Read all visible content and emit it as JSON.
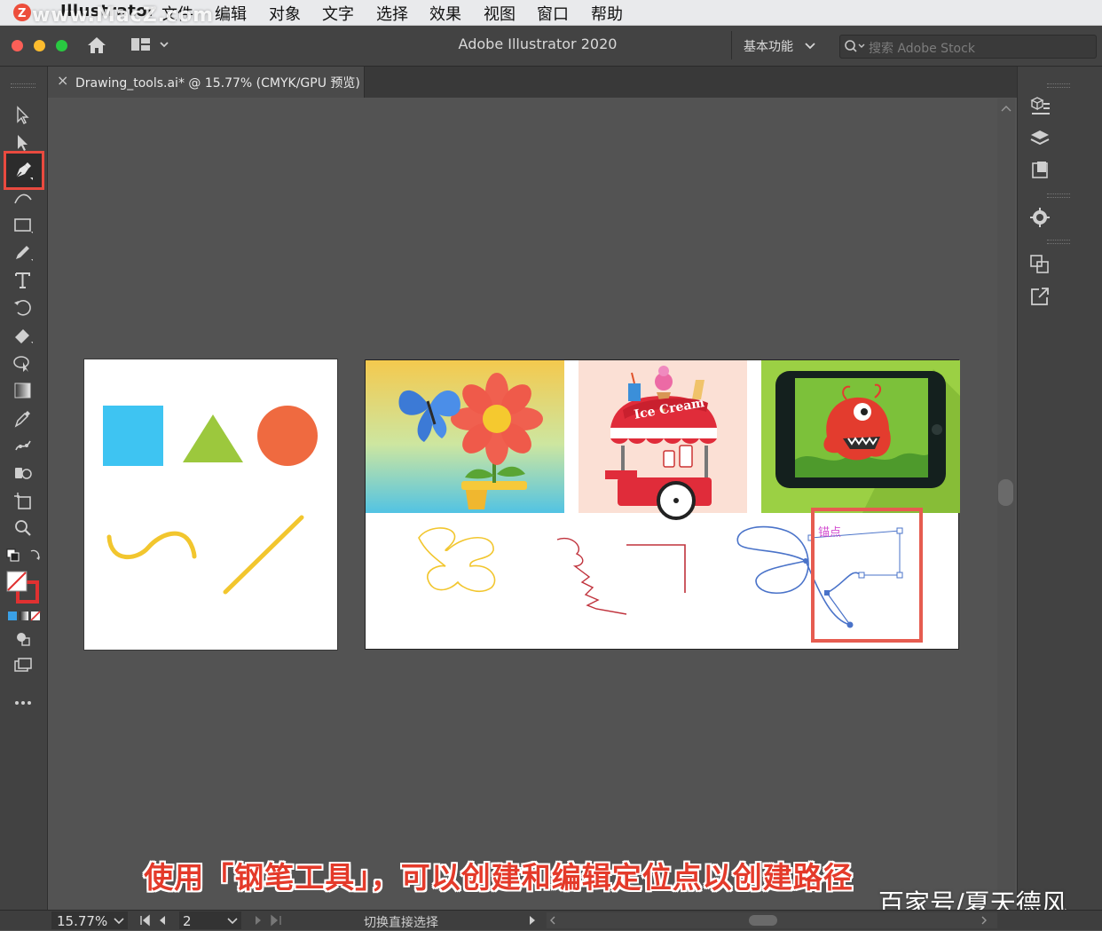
{
  "menubar": {
    "app_name": "Illustrator",
    "items": [
      "文件",
      "编辑",
      "对象",
      "文字",
      "选择",
      "效果",
      "视图",
      "窗口",
      "帮助"
    ]
  },
  "watermark": "www.MacZ.com",
  "titlebar": {
    "title": "Adobe Illustrator 2020",
    "workspace": "基本功能",
    "search_placeholder": "搜索 Adobe Stock"
  },
  "document_tab": {
    "label": "Drawing_tools.ai* @ 15.77% (CMYK/GPU 预览)",
    "close": "×"
  },
  "canvas": {
    "anchor_label": "锚点",
    "ice_cream_text": "Ice Cream"
  },
  "caption": "使用「钢笔工具」，可以创建和编辑定位点以创建路径",
  "attribution": "百家号/夏天德风",
  "statusbar": {
    "zoom": "15.77%",
    "page": "2",
    "status_text": "切换直接选择"
  },
  "colors": {
    "highlight_red": "#e94a3f",
    "square_blue": "#3ec4f2",
    "triangle_green": "#9cc83d",
    "circle_orange": "#ef6a40",
    "curve_yellow": "#f2c62e",
    "path_blue": "#4a73c9",
    "path_red": "#c0323c"
  }
}
